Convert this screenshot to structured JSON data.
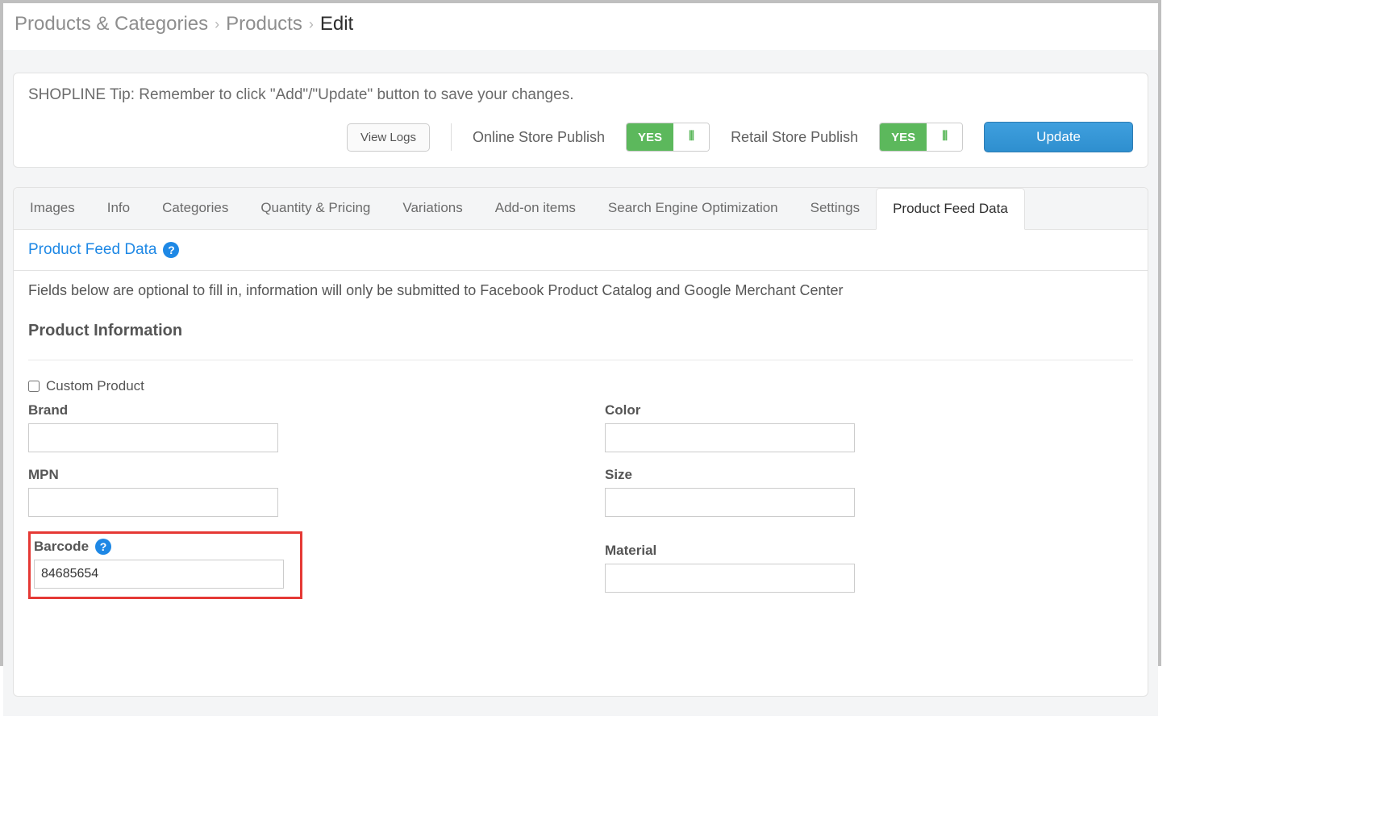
{
  "breadcrumb": {
    "root": "Products & Categories",
    "parent": "Products",
    "current": "Edit"
  },
  "tip": {
    "text": "SHOPLINE Tip: Remember to click \"Add\"/\"Update\" button to save your changes.",
    "view_logs": "View Logs",
    "online_publish_label": "Online Store Publish",
    "retail_publish_label": "Retail Store Publish",
    "toggle_yes": "YES",
    "update": "Update"
  },
  "tabs": [
    "Images",
    "Info",
    "Categories",
    "Quantity & Pricing",
    "Variations",
    "Add-on items",
    "Search Engine Optimization",
    "Settings",
    "Product Feed Data"
  ],
  "feed": {
    "heading": "Product Feed Data",
    "description": "Fields below are optional to fill in, information will only be submitted to Facebook Product Catalog and Google Merchant Center",
    "subheading": "Product Information",
    "custom_product_label": "Custom Product",
    "fields": {
      "brand": {
        "label": "Brand",
        "value": ""
      },
      "mpn": {
        "label": "MPN",
        "value": ""
      },
      "barcode": {
        "label": "Barcode",
        "value": "84685654"
      },
      "color": {
        "label": "Color",
        "value": ""
      },
      "size": {
        "label": "Size",
        "value": ""
      },
      "material": {
        "label": "Material",
        "value": ""
      }
    }
  }
}
